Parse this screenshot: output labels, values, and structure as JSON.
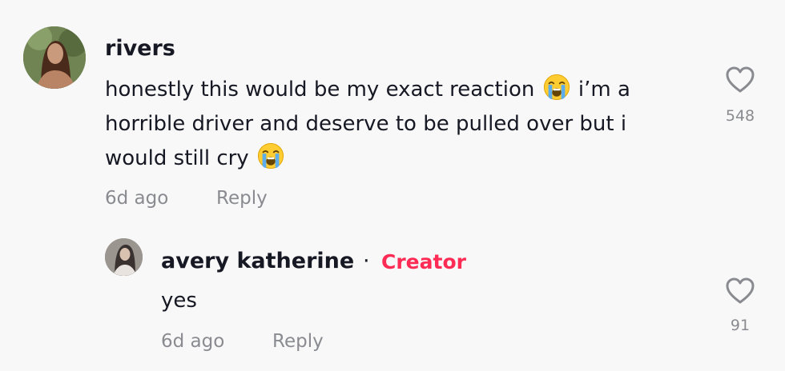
{
  "comment": {
    "username": "rivers",
    "text_line1_a": "honestly this would be my exact reaction",
    "text_line1_b": "i’m a",
    "text_line2": "horrible driver and deserve to be pulled over but i",
    "text_line3": "would still cry",
    "emoji": "loudly-crying-face",
    "date": "6d ago",
    "reply_label": "Reply",
    "like_count": "548"
  },
  "reply": {
    "username": "avery katherine",
    "separator": "·",
    "badge": "Creator",
    "text": "yes",
    "date": "6d ago",
    "reply_label": "Reply",
    "like_count": "91"
  },
  "colors": {
    "background": "#f8f8f8",
    "text": "#161823",
    "muted": "#8a8b91",
    "creator": "#fe2c55"
  }
}
